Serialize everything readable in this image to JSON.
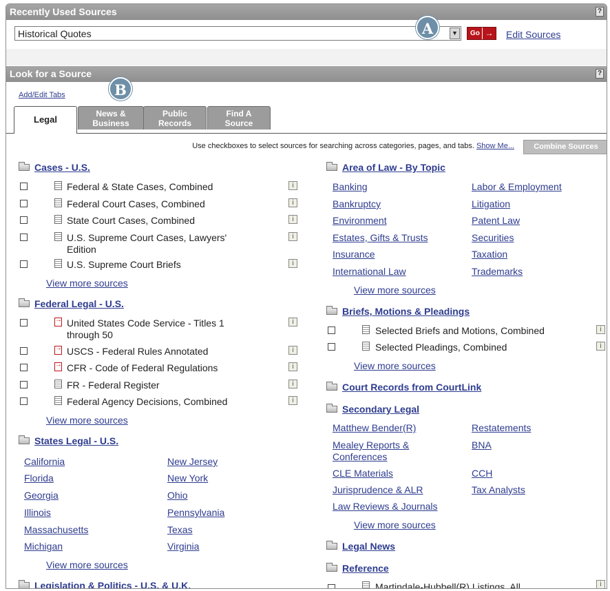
{
  "recent": {
    "title": "Recently Used Sources",
    "help": "?",
    "selected": "Historical Quotes",
    "go": "Go",
    "go_arrow": "→",
    "edit": "Edit Sources"
  },
  "markers": {
    "a": "A",
    "b": "B"
  },
  "look": {
    "title": "Look for a Source",
    "help": "?",
    "add_edit_tabs": "Add/Edit Tabs",
    "tabs": [
      {
        "l1": "Legal",
        "l2": ""
      },
      {
        "l1": "News &",
        "l2": "Business"
      },
      {
        "l1": "Public",
        "l2": "Records"
      },
      {
        "l1": "Find A",
        "l2": "Source"
      }
    ],
    "info_text": "Use checkboxes to select sources for searching across categories, pages, and tabs.",
    "show_me": "Show Me...",
    "combine": "Combine Sources"
  },
  "left": {
    "cases": {
      "title": "Cases - U.S.",
      "items": [
        "Federal & State Cases, Combined",
        "Federal Court Cases, Combined",
        "State Court Cases, Combined",
        "U.S. Supreme Court Cases, Lawyers'",
        "Edition",
        "U.S. Supreme Court Briefs"
      ],
      "more": "View more sources"
    },
    "federal": {
      "title": "Federal Legal - U.S.",
      "items": [
        "United States Code Service - Titles 1",
        "through 50",
        "USCS - Federal Rules Annotated",
        "CFR - Code of Federal Regulations",
        "FR - Federal Register",
        "Federal Agency Decisions, Combined"
      ],
      "more": "View more sources"
    },
    "states": {
      "title": "States Legal - U.S.",
      "col1": [
        "California",
        "Florida",
        "Georgia",
        "Illinois",
        "Massachusetts",
        "Michigan"
      ],
      "col2": [
        "New Jersey",
        "New York",
        "Ohio",
        "Pennsylvania",
        "Texas",
        "Virginia"
      ],
      "more": "View more sources"
    },
    "legislation": {
      "title": "Legislation & Politics - U.S. & U.K."
    }
  },
  "right": {
    "area": {
      "title": "Area of Law - By Topic",
      "col1": [
        "Banking",
        "Bankruptcy",
        "Environment",
        "Estates, Gifts & Trusts",
        "Insurance",
        "International Law"
      ],
      "col2": [
        "Labor & Employment",
        "Litigation",
        "Patent Law",
        "Securities",
        "Taxation",
        "Trademarks"
      ],
      "more": "View more sources"
    },
    "briefs": {
      "title": "Briefs, Motions & Pleadings",
      "items": [
        "Selected Briefs and Motions, Combined",
        "Selected Pleadings, Combined"
      ],
      "more": "View more sources"
    },
    "courtlink": {
      "title": "Court Records from CourtLink"
    },
    "secondary": {
      "title": "Secondary Legal",
      "col1": [
        "Matthew Bender(R)",
        "Mealey Reports &",
        "Conferences",
        "CLE Materials",
        "Jurisprudence & ALR",
        "Law Reviews & Journals"
      ],
      "col2": [
        "Restatements",
        "BNA",
        "CCH",
        "Tax Analysts"
      ],
      "more": "View more sources"
    },
    "legal_news": {
      "title": "Legal News"
    },
    "reference": {
      "title": "Reference",
      "items": [
        "Martindale-Hubbell(R) Listings, All"
      ]
    }
  },
  "info_icon": "i"
}
